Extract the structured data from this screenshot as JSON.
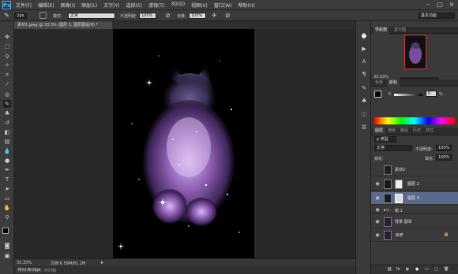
{
  "app": {
    "logo": "Ps"
  },
  "menu": [
    "文件(F)",
    "编辑(E)",
    "图像(I)",
    "图层(L)",
    "文字(Y)",
    "选择(S)",
    "滤镜(T)",
    "3D(D)",
    "视图(V)",
    "窗口(W)",
    "帮助(H)"
  ],
  "window_controls": [
    "–",
    "□",
    "×"
  ],
  "options": {
    "brush_size": "1px",
    "mode_label": "模式:",
    "mode_value": "正常",
    "opacity_label": "不透明度:",
    "opacity_value": "100%",
    "flow_label": "流量:",
    "flow_value": "100%",
    "workspace": "基本功能"
  },
  "document_tab": "素材1.jpeg @ 33.3% (图层 3, 图层蒙版/8) *",
  "status": {
    "zoom": "33.33%",
    "doc_info": "文档:6.59M/81.2M"
  },
  "bottom_tabs": [
    "Mini Bridge",
    "时间轴"
  ],
  "navigator": {
    "tabs": [
      "导航器",
      "直方图"
    ],
    "zoom": "33.33%"
  },
  "color_panel": {
    "tabs": [
      "色板",
      "颜色"
    ],
    "channel": "K",
    "value": "0",
    "unit": "%"
  },
  "adjust_tabs": [
    "调整",
    "样式"
  ],
  "layers_panel": {
    "tabs": [
      "图层",
      "通道",
      "路径",
      "历史",
      "样式"
    ],
    "filter_label": "ρ 类型",
    "blend_mode": "正常",
    "opacity_label": "不透明度:",
    "opacity": "100%",
    "lock_label": "锁定:",
    "fill_label": "填充:",
    "fill": "100%",
    "layers": [
      {
        "name": "素材2",
        "visible": false,
        "selected": false
      },
      {
        "name": "图层 2",
        "visible": true,
        "selected": false
      },
      {
        "name": "图层 3",
        "visible": true,
        "selected": true
      },
      {
        "name": "组 1",
        "visible": true,
        "selected": false
      },
      {
        "name": "背景 副本",
        "visible": true,
        "selected": false
      },
      {
        "name": "背景",
        "visible": true,
        "selected": false
      }
    ]
  },
  "icons": [
    "move-icon",
    "marquee-icon",
    "lasso-icon",
    "quick-select-icon",
    "crop-icon",
    "eyedropper-icon",
    "healing-brush-icon",
    "brush-icon",
    "clone-stamp-icon",
    "history-brush-icon",
    "eraser-icon",
    "gradient-icon",
    "blur-icon",
    "dodge-icon",
    "pen-icon",
    "type-icon",
    "path-select-icon",
    "shape-icon",
    "hand-icon",
    "zoom-icon"
  ],
  "colors": {
    "accent": "#5ab2f0",
    "selected_layer": "#5b6a8c",
    "nav_frame": "#dd3333"
  }
}
